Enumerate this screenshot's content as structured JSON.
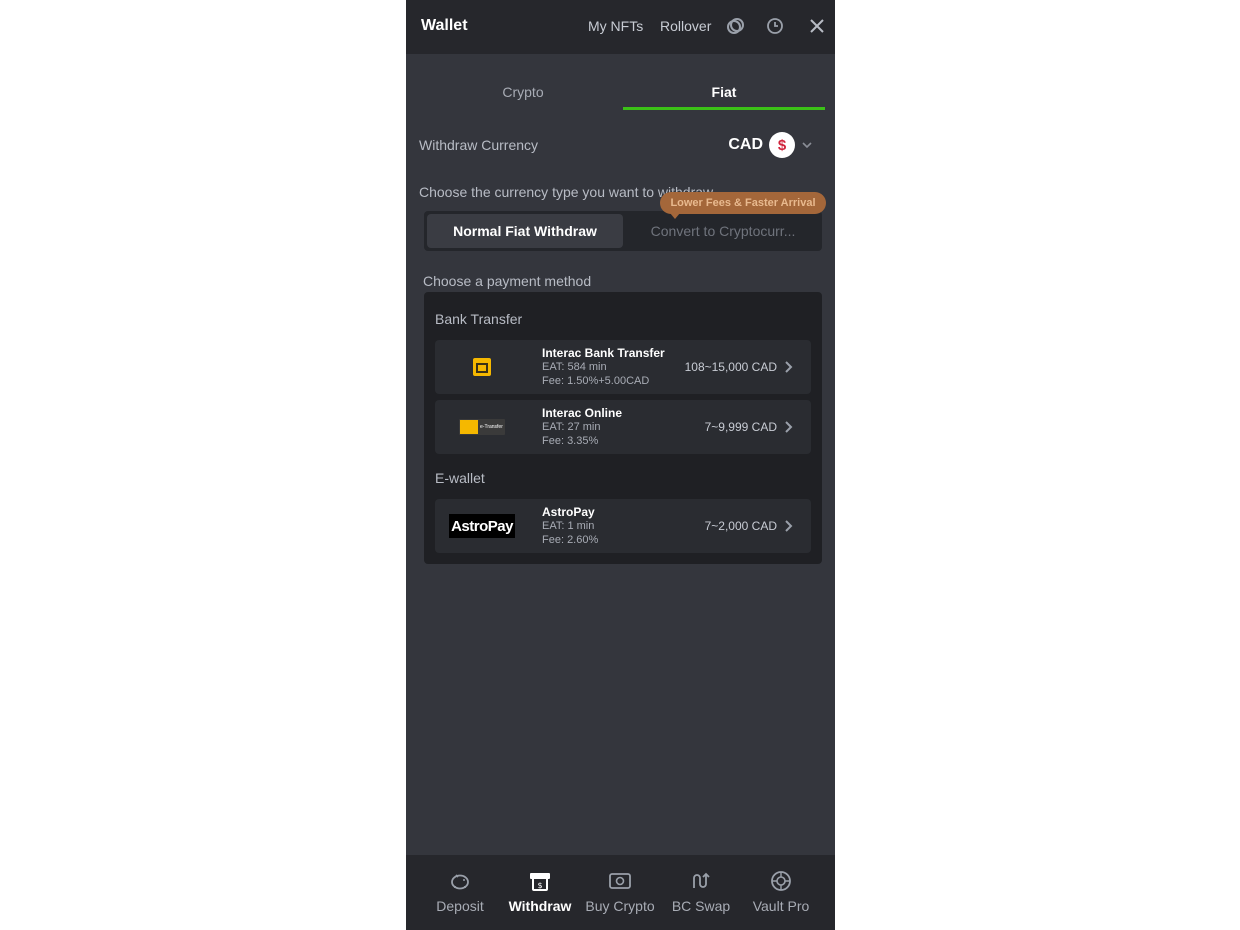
{
  "header": {
    "title": "Wallet",
    "nav": [
      "My NFTs",
      "Rollover"
    ],
    "icons": [
      "vault-coin-icon",
      "history-clock-icon",
      "close-icon"
    ]
  },
  "tabs": [
    {
      "label": "Crypto",
      "active": false
    },
    {
      "label": "Fiat",
      "active": true
    }
  ],
  "withdraw_currency": {
    "label": "Withdraw Currency",
    "code": "CAD",
    "symbol": "$"
  },
  "currency_type": {
    "prompt": "Choose the currency type you want to withdraw",
    "options": [
      "Normal Fiat Withdraw",
      "Convert to Cryptocurr..."
    ],
    "selected": "Normal Fiat Withdraw",
    "promo": "Lower Fees & Faster Arrival"
  },
  "payment": {
    "prompt": "Choose a payment method",
    "groups": [
      {
        "title": "Bank Transfer",
        "methods": [
          {
            "name": "Interac Bank Transfer",
            "eat": "EAT: 584 min",
            "fee": "Fee: 1.50%+5.00CAD",
            "range": "108~15,000 CAD",
            "logo": "interac-logo"
          },
          {
            "name": "Interac Online",
            "eat": "EAT: 27 min",
            "fee": "Fee: 3.35%",
            "range": "7~9,999 CAD",
            "logo": "interac-etransfer-logo",
            "logo_text": "e-Transfer"
          }
        ]
      },
      {
        "title": "E-wallet",
        "methods": [
          {
            "name": "AstroPay",
            "eat": "EAT: 1 min",
            "fee": "Fee: 2.60%",
            "range": "7~2,000 CAD",
            "logo": "astropay-logo",
            "logo_text": "AstroPay"
          }
        ]
      }
    ]
  },
  "bottom_nav": [
    {
      "label": "Deposit",
      "icon": "piggy-bank-icon",
      "active": false
    },
    {
      "label": "Withdraw",
      "icon": "withdraw-icon",
      "active": true
    },
    {
      "label": "Buy Crypto",
      "icon": "cash-icon",
      "active": false
    },
    {
      "label": "BC Swap",
      "icon": "swap-icon",
      "active": false
    },
    {
      "label": "Vault Pro",
      "icon": "vault-icon",
      "active": false
    }
  ],
  "colors": {
    "panel_bg": "#34363d",
    "header_bg": "#26272c",
    "accent_green": "#3bc117",
    "promo_orange": "#a4673a",
    "card_bg": "#1f2024"
  }
}
